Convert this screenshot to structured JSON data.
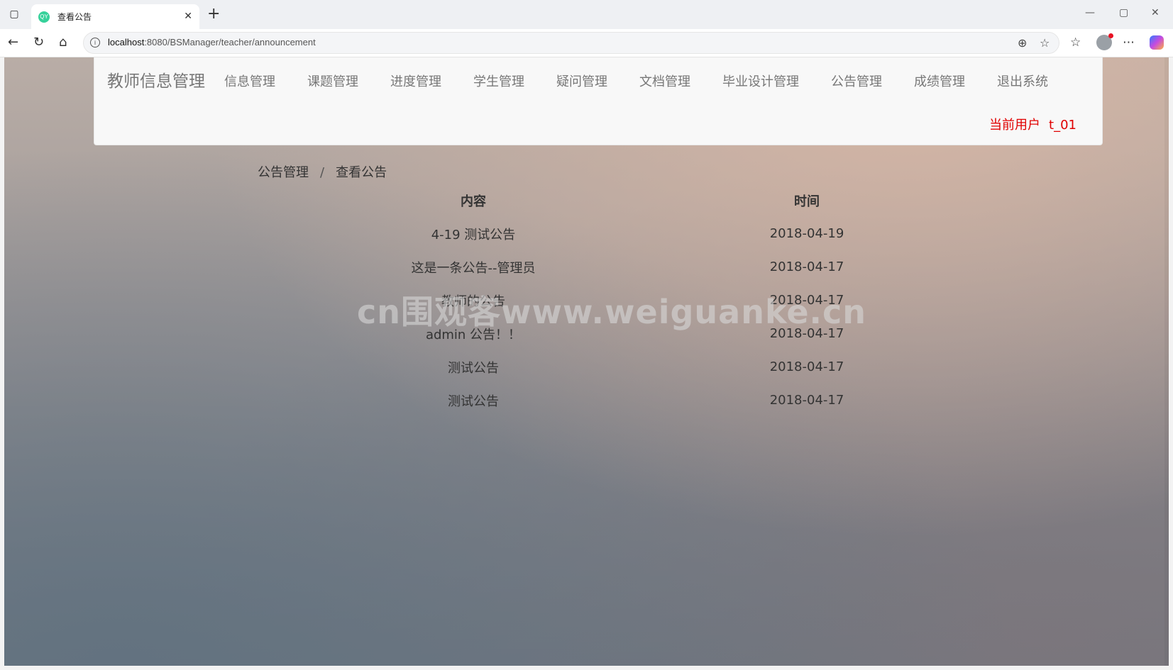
{
  "browser": {
    "tab_title": "查看公告",
    "favicon_text": "QY",
    "url_host": "localhost",
    "url_rest": ":8080/BSManager/teacher/announcement",
    "icons": {
      "tab_actions": "tab-actions-icon",
      "new_tab": "plus-icon",
      "back": "back-arrow-icon",
      "reload": "reload-icon",
      "home": "home-icon",
      "zoom": "zoom-icon",
      "favorite": "star-icon",
      "favorites_list": "favorites-icon",
      "profile": "profile-avatar-icon",
      "more": "more-icon",
      "copilot": "copilot-icon",
      "minimize": "minimize-icon",
      "maximize": "maximize-icon",
      "close": "close-icon"
    }
  },
  "navbar": {
    "brand": "教师信息管理",
    "menu": [
      {
        "label": "信息管理"
      },
      {
        "label": "课题管理"
      },
      {
        "label": "进度管理"
      },
      {
        "label": "学生管理"
      },
      {
        "label": "疑问管理"
      },
      {
        "label": "文档管理"
      },
      {
        "label": "毕业设计管理"
      },
      {
        "label": "公告管理"
      },
      {
        "label": "成绩管理"
      },
      {
        "label": "退出系统"
      }
    ],
    "current_user_label": "当前用户",
    "current_user_name": "t_01"
  },
  "breadcrumb": {
    "parent": "公告管理",
    "separator": "/",
    "current": "查看公告"
  },
  "table": {
    "headers": [
      "内容",
      "时间"
    ],
    "rows": [
      {
        "content": "4-19 测试公告",
        "time": "2018-04-19"
      },
      {
        "content": "这是一条公告--管理员",
        "time": "2018-04-17"
      },
      {
        "content": "教师的公告",
        "time": "2018-04-17"
      },
      {
        "content": "admin 公告！！",
        "time": "2018-04-17"
      },
      {
        "content": "测试公告",
        "time": "2018-04-17"
      },
      {
        "content": "测试公告",
        "time": "2018-04-17"
      }
    ]
  },
  "watermark": "cn围观客www.weiguanke.cn",
  "colors": {
    "current_user": "#e00000",
    "navbar_bg": "#f8f8f8",
    "menu_text": "#777777"
  }
}
